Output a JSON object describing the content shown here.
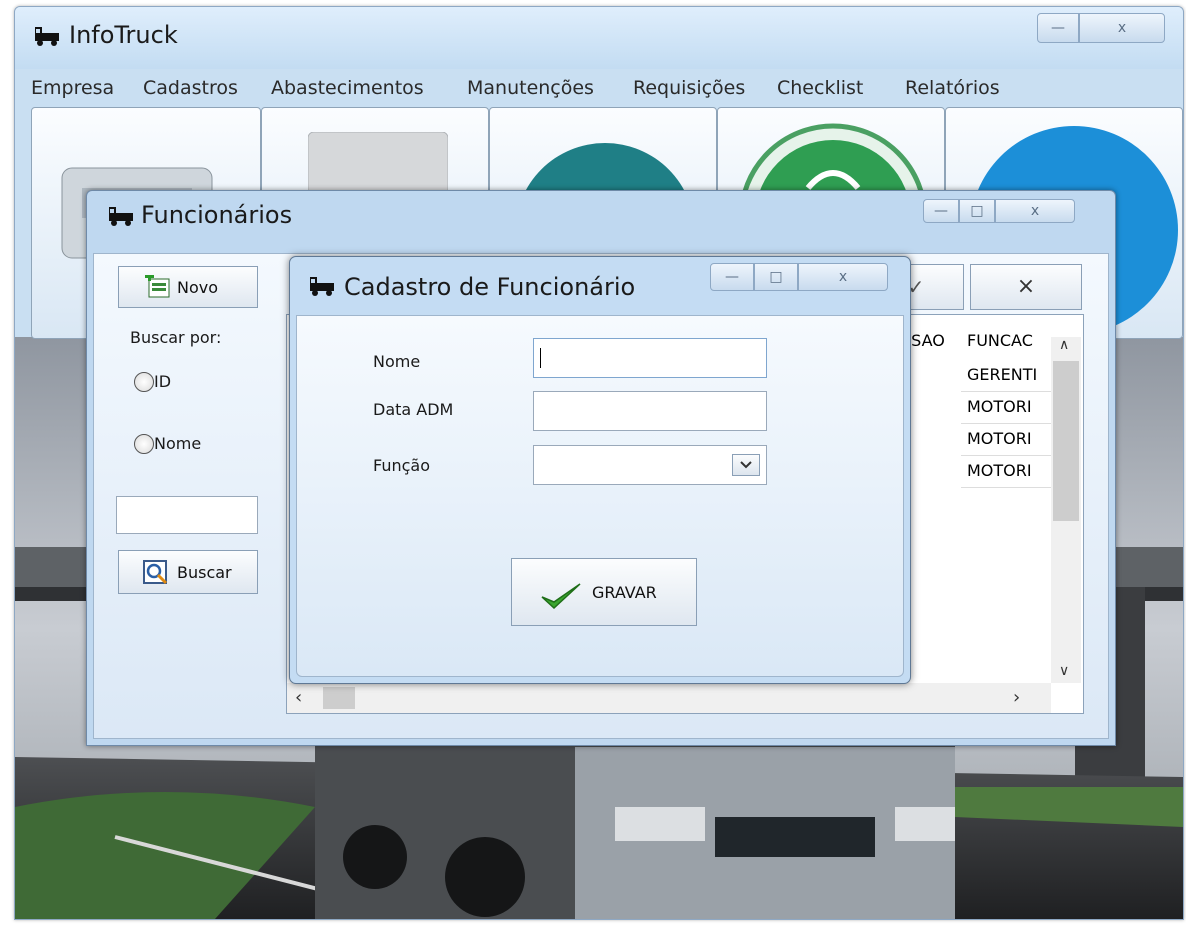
{
  "main_window": {
    "title": "InfoTruck",
    "minimize_glyph": "—",
    "close_glyph": "x",
    "menu": [
      "Empresa",
      "Cadastros",
      "Abastecimentos",
      "Manutenções",
      "Requisições",
      "Checklist",
      "Relatórios"
    ]
  },
  "tiles": [
    {
      "icon": "truck-icon"
    },
    {
      "icon": "blank-card-icon"
    },
    {
      "icon": "teal-circle-icon"
    },
    {
      "icon": "fuel-pump-icon"
    },
    {
      "icon": "exit-icon"
    }
  ],
  "funcionarios_window": {
    "title": "Funcionários",
    "new_button": "Novo",
    "search_by_label": "Buscar por:",
    "radio_id": "ID",
    "radio_nome": "Nome",
    "search_value": "",
    "search_button": "Buscar",
    "toolbar_close_glyph": "×",
    "toolbar_edit_glyph": "✓",
    "grid": {
      "columns": [
        "SSAO",
        "FUNCAC"
      ],
      "rows": [
        [
          "",
          "GERENTI"
        ],
        [
          "",
          "MOTORI"
        ],
        [
          "",
          "MOTORI"
        ],
        [
          "",
          "MOTORI"
        ]
      ]
    }
  },
  "cadastro_window": {
    "title": "Cadastro de Funcionário",
    "nome_label": "Nome",
    "nome_value": "",
    "data_adm_label": "Data  ADM",
    "data_adm_value": "",
    "funcao_label": "Função",
    "funcao_value": "",
    "save_button": "GRAVAR"
  },
  "colors": {
    "window_frame": "#c9dff2",
    "dialog_body": "#e6f0fa",
    "check_green": "#3aa52e"
  }
}
